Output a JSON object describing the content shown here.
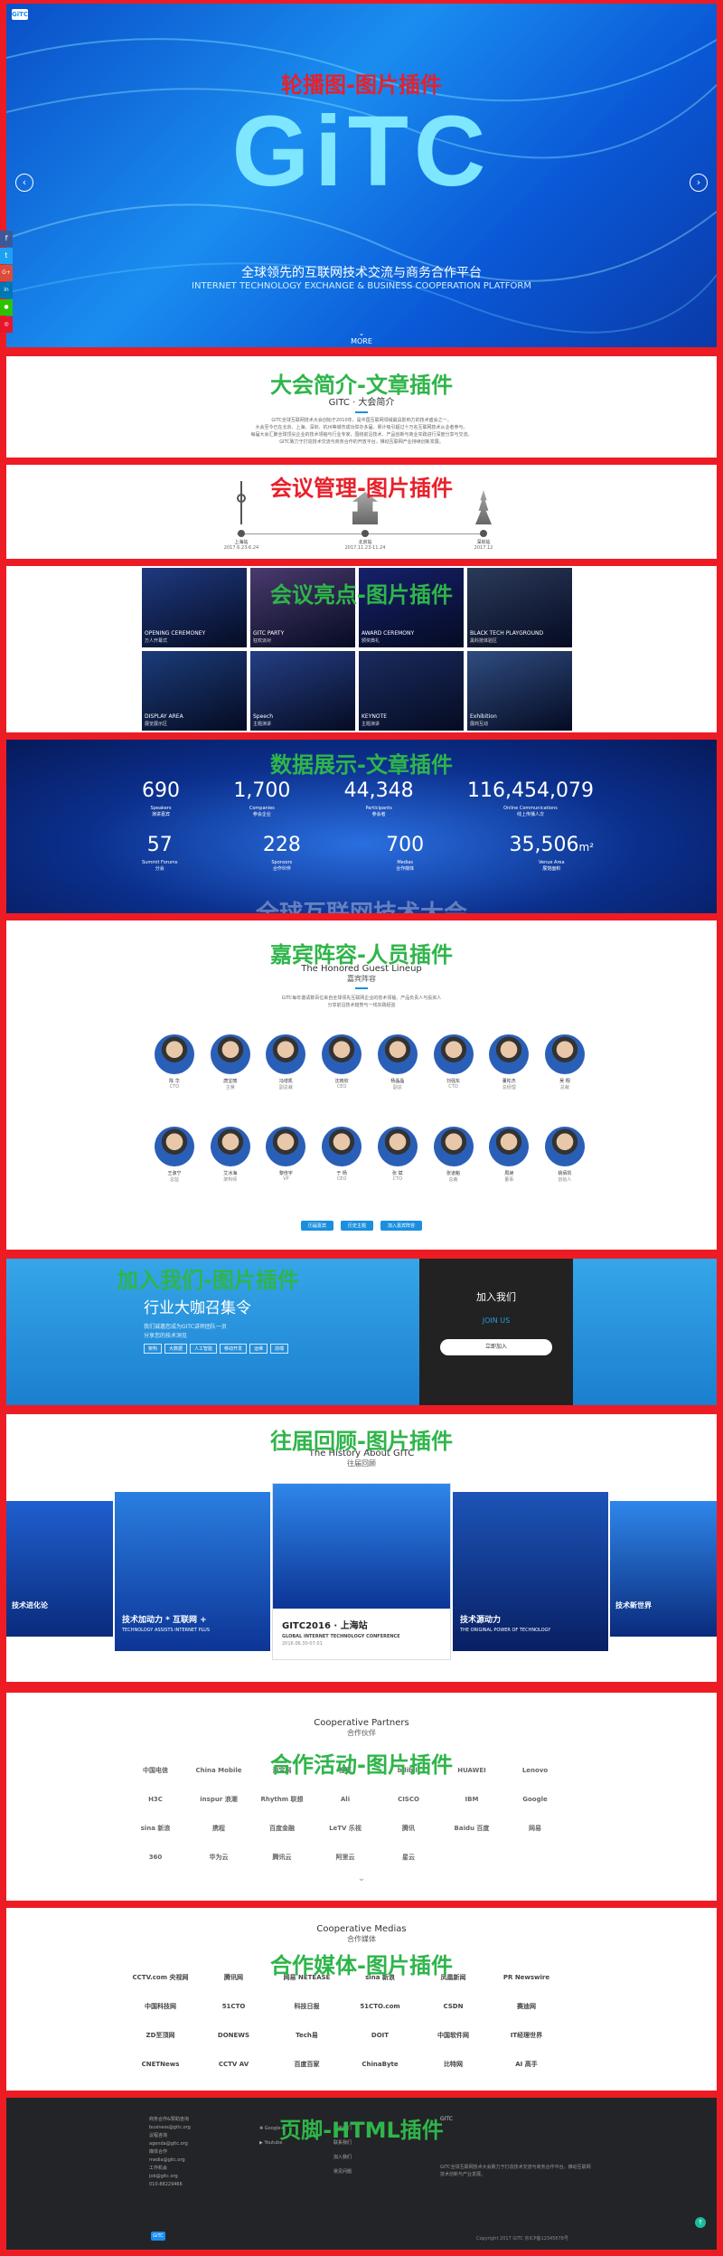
{
  "hero": {
    "annotation": "轮播图-图片插件",
    "logo": "GiTC",
    "slogan_cn": "全球领先的互联网技术交流与商务合作平台",
    "slogan_en": "INTERNET TECHNOLOGY EXCHANGE & BUSINESS COOPERATION PLATFORM",
    "more": "MORE"
  },
  "social": [
    "f",
    "t",
    "G+",
    "in",
    "微",
    "微博"
  ],
  "intro": {
    "annotation": "大会简介-文章插件",
    "title": "GITC · 大会简介",
    "p1": "GITC全球互联网技术大会创始于2010年，是中国互联网领域最具影响力的技术盛会之一。",
    "p2": "大会至今已在北京、上海、深圳、杭州等城市成功举办多届，累计吸引超过十万名互联网技术从业者参与。",
    "p3": "每届大会汇聚全球顶尖企业的技术领袖与行业专家，围绕前沿技术、产品创新与商业实践进行深度分享与交流。",
    "p4": "GITC致力于打造技术交流与商务合作的开放平台，推动互联网产业持续创新发展。"
  },
  "meeting": {
    "annotation": "会议管理-图片插件",
    "stops": [
      {
        "city": "上海站",
        "date": "2017.6.23-6.24"
      },
      {
        "city": "北京站",
        "date": "2017.11.23-11.24"
      },
      {
        "city": "深圳站",
        "date": "2017.12"
      }
    ]
  },
  "highlights": {
    "annotation": "会议亮点-图片插件",
    "items": [
      {
        "en": "OPENING CEREMONEY",
        "cn": "万人开幕式"
      },
      {
        "en": "GITC PARTY",
        "cn": "狂欢派对"
      },
      {
        "en": "AWARD CEREMONY",
        "cn": "颁奖典礼"
      },
      {
        "en": "BLACK TECH PLAYGROUND",
        "cn": "黑科技体验区"
      },
      {
        "en": "DISPLAY AREA",
        "cn": "展览展示区"
      },
      {
        "en": "Speech",
        "cn": "主题演讲"
      },
      {
        "en": "KEYNOTE",
        "cn": "主题演讲"
      },
      {
        "en": "Exhibition",
        "cn": "展商互动"
      }
    ]
  },
  "stats": {
    "annotation": "数据展示-文章插件",
    "row1": [
      {
        "num": "690",
        "en": "Speakers",
        "cn": "演讲嘉宾"
      },
      {
        "num": "1,700",
        "en": "Companies",
        "cn": "参会企业"
      },
      {
        "num": "44,348",
        "en": "Participants",
        "cn": "参会者"
      },
      {
        "num": "116,454,079",
        "en": "Online Communications",
        "cn": "线上传播人次"
      }
    ],
    "row2": [
      {
        "num": "57",
        "en": "Summit Forums",
        "cn": "分会"
      },
      {
        "num": "228",
        "en": "Sponsors",
        "cn": "合作伙伴"
      },
      {
        "num": "700",
        "en": "Medias",
        "cn": "合作媒体"
      },
      {
        "num": "35,506",
        "unit": "m²",
        "en": "Venue Area",
        "cn": "展馆面积"
      }
    ],
    "bgtext": "全球互联网技术大会"
  },
  "guests": {
    "annotation": "嘉宾阵容-人员插件",
    "en": "The Honored Guest Lineup",
    "cn": "嘉宾阵容",
    "desc1": "GITC每年邀请数百位来自全球领先互联网企业的技术领袖、产品负责人与投资人",
    "desc2": "分享前沿技术趋势与一线实践经验",
    "row1": [
      {
        "name": "陈 华",
        "title": "CTO"
      },
      {
        "name": "唐宝丽",
        "title": "主席"
      },
      {
        "name": "冯增凯",
        "title": "副总裁"
      },
      {
        "name": "沈晓欣",
        "title": "CEO"
      },
      {
        "name": "杨晶晶",
        "title": "副总"
      },
      {
        "name": "刘强东",
        "title": "CTO"
      },
      {
        "name": "董松杰",
        "title": "总经理"
      },
      {
        "name": "吴 翔",
        "title": "总裁"
      }
    ],
    "row2": [
      {
        "name": "王淑宁",
        "title": "总监"
      },
      {
        "name": "艾冰海",
        "title": "架构师"
      },
      {
        "name": "黎佳宇",
        "title": "VP"
      },
      {
        "name": "于 杨",
        "title": "CEO"
      },
      {
        "name": "张 斌",
        "title": "CTO"
      },
      {
        "name": "张道魁",
        "title": "总裁"
      },
      {
        "name": "周昶",
        "title": "董事"
      },
      {
        "name": "姚佰凯",
        "title": "创始人"
      }
    ],
    "buttons": [
      "历届嘉宾",
      "历史主题",
      "加入嘉宾阵容"
    ]
  },
  "join": {
    "annotation": "加入我们-图片插件",
    "title": "行业大咖召集令",
    "l1": "我们诚邀您成为GITC讲师团队一员",
    "l2": "分享您的技术洞见",
    "tags": [
      "架构",
      "大数据",
      "人工智能",
      "移动开发",
      "运维",
      "前端"
    ],
    "panel_title": "加入我们",
    "panel_en": "JOIN US",
    "panel_btn": "立即加入"
  },
  "history": {
    "annotation": "往届回顾-图片插件",
    "en": "The History About GITC",
    "cn": "往届回顾",
    "center_title": "GITC2016 · 上海站",
    "center_sub": "GLOBAL INTERNET TECHNOLOGY CONFERENCE",
    "center_date": "2016.06.30-07.01",
    "left_title": "技术加动力 * 互联网 +",
    "left_sub": "TECHNOLOGY ASSISTS INTERNET PLUS",
    "far_left": "技术进化论",
    "right_title": "技术源动力",
    "right_sub": "THE ORIGINAL POWER OF TECHNOLOGY",
    "far_right": "技术新世界"
  },
  "partners": {
    "annotation": "合作活动-图片插件",
    "en": "Cooperative Partners",
    "cn": "合作伙伴",
    "logos": [
      "中国电信",
      "China Mobile",
      "淘宝网",
      "搜狐",
      "bilibili",
      "HUAWEI",
      "Lenovo",
      "H3C",
      "inspur 浪潮",
      "Rhythm 联想",
      "Ali",
      "CISCO",
      "IBM",
      "Google",
      "sina 新浪",
      "携程",
      "百度金融",
      "LeTV 乐视",
      "腾讯",
      "Baidu 百度",
      "网易",
      "360",
      "华为云",
      "腾讯云",
      "阿里云",
      "星云"
    ]
  },
  "media": {
    "annotation": "合作媒体-图片插件",
    "en": "Cooperative Medias",
    "cn": "合作媒体",
    "logos": [
      "CCTV.com 央视网",
      "腾讯网",
      "网易 NETEASE",
      "sina 新浪",
      "凤凰新闻",
      "PR Newswire",
      "中国科技网",
      "51CTO",
      "科技日报",
      "51CTO.com",
      "CSDN",
      "赛迪网",
      "ZD至顶网",
      "DONEWS",
      "Tech易",
      "DOIT",
      "中国软件网",
      "IT经理世界",
      "CNETNews",
      "CCTV AV",
      "百度百家",
      "ChinaByte",
      "比特网",
      "AI 高手"
    ]
  },
  "footer": {
    "annotation": "页脚-HTML插件",
    "c1": [
      "商务合作&赞助咨询",
      "business@gitc.org",
      "议程咨询",
      "agenda@gitc.org",
      "媒体合作",
      "media@gitc.org",
      "工作机会",
      "job@gitc.org",
      "010-88229466"
    ],
    "c2": [
      "Google+",
      "Youtube"
    ],
    "c3": [
      "关于我们",
      "联系我们",
      "加入我们",
      "常见问题"
    ],
    "c4title": "GITC",
    "c4": "GITC全球互联网技术大会致力于打造技术交流与商务合作平台，推动互联网技术创新与产业发展。",
    "copyright": "Copyright 2017 GITC 京ICP备12345678号"
  }
}
